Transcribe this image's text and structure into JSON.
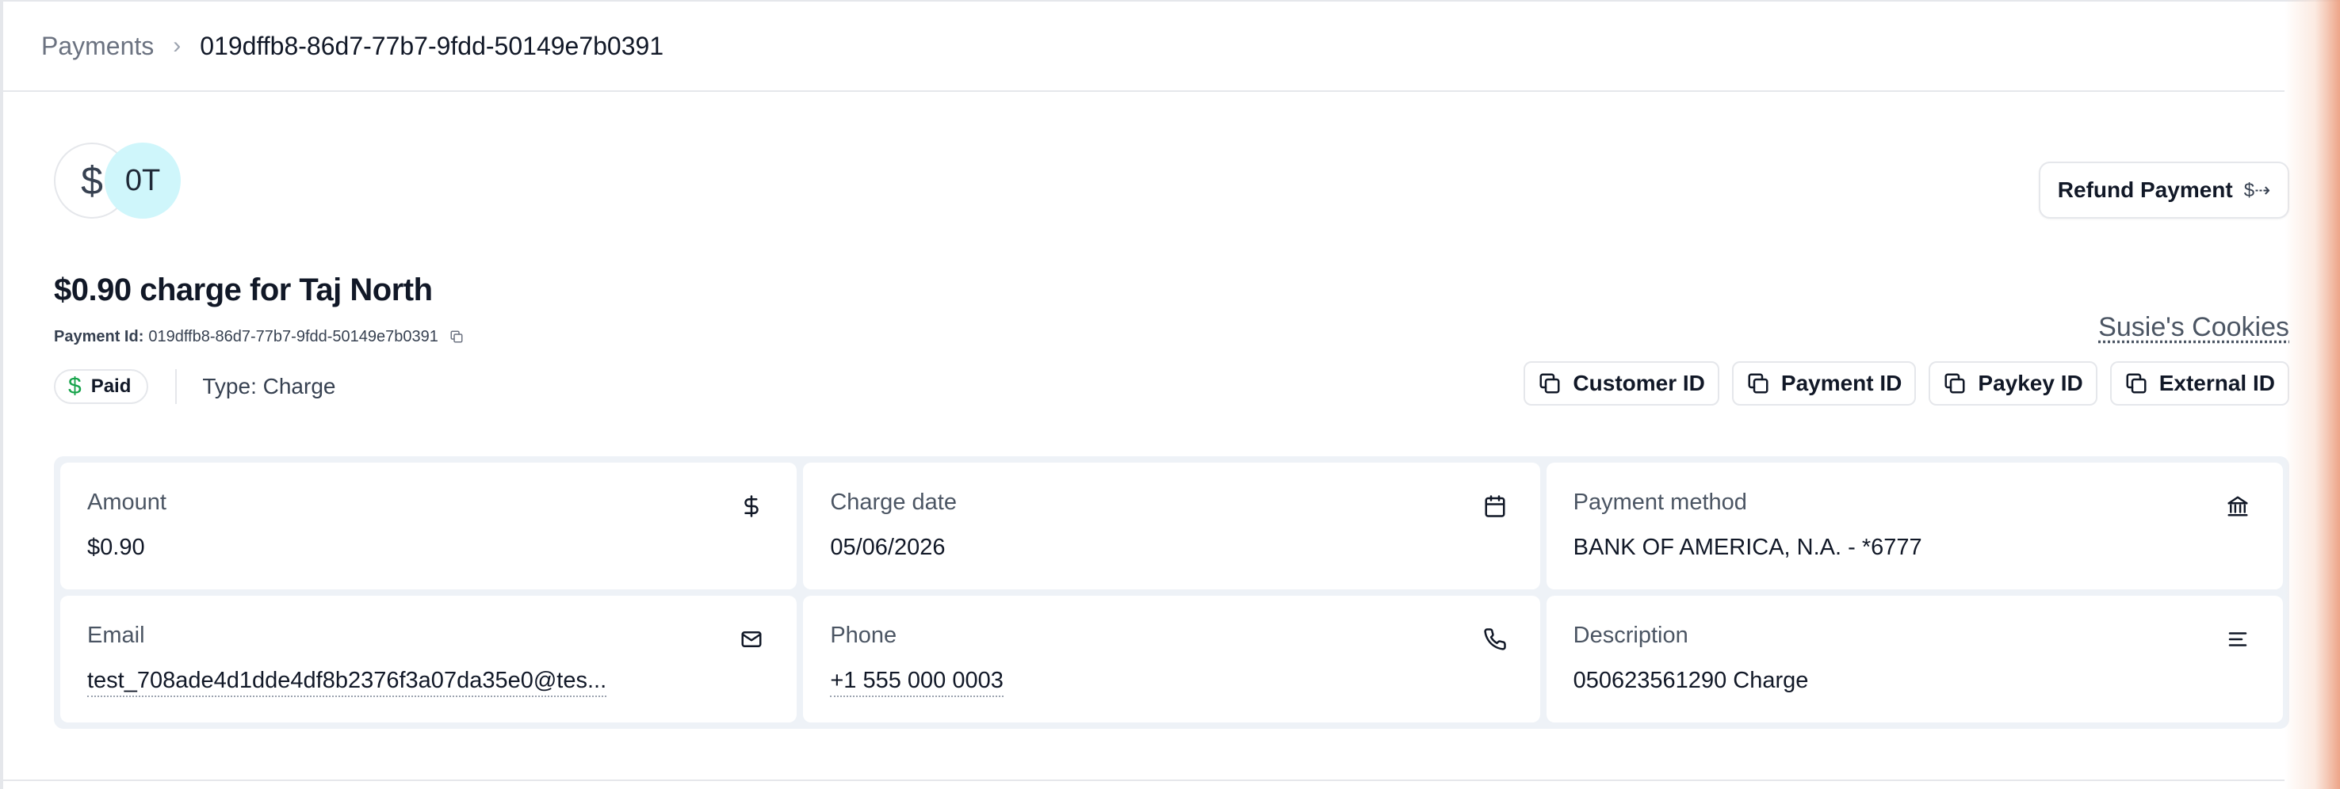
{
  "breadcrumb": {
    "parent": "Payments",
    "separator": "›",
    "current": "019dffb8-86d7-77b7-9fdd-50149e7b0391"
  },
  "avatars": {
    "dollar_symbol": "$",
    "initials": "0T"
  },
  "refund_button": {
    "label": "Refund Payment",
    "icon": "$⇢"
  },
  "title": "$0.90 charge for Taj North",
  "payment_id": {
    "label": "Payment Id:",
    "value": "019dffb8-86d7-77b7-9fdd-50149e7b0391"
  },
  "merchant": "Susie's Cookies",
  "status": {
    "badge_icon": "$",
    "badge_label": "Paid",
    "type_text": "Type: Charge"
  },
  "id_buttons": [
    {
      "label": "Customer ID"
    },
    {
      "label": "Payment ID"
    },
    {
      "label": "Paykey ID"
    },
    {
      "label": "External ID"
    }
  ],
  "details": {
    "amount": {
      "label": "Amount",
      "value": "$0.90",
      "icon": "dollar-icon"
    },
    "charge_date": {
      "label": "Charge date",
      "value": "05/06/2026",
      "icon": "calendar-icon"
    },
    "payment_method": {
      "label": "Payment method",
      "value": "BANK OF AMERICA, N.A. - *6777",
      "icon": "bank-icon"
    },
    "email": {
      "label": "Email",
      "value": "test_708ade4d1dde4df8b2376f3a07da35e0@tes...",
      "icon": "mail-icon"
    },
    "phone": {
      "label": "Phone",
      "value": "+1 555 000 0003",
      "icon": "phone-icon"
    },
    "description": {
      "label": "Description",
      "value": "050623561290 Charge",
      "icon": "align-left-icon"
    }
  },
  "colors": {
    "paid_green": "#16a34a",
    "avatar_bg": "#cff6fb",
    "panel_bg": "#eef2f7"
  }
}
